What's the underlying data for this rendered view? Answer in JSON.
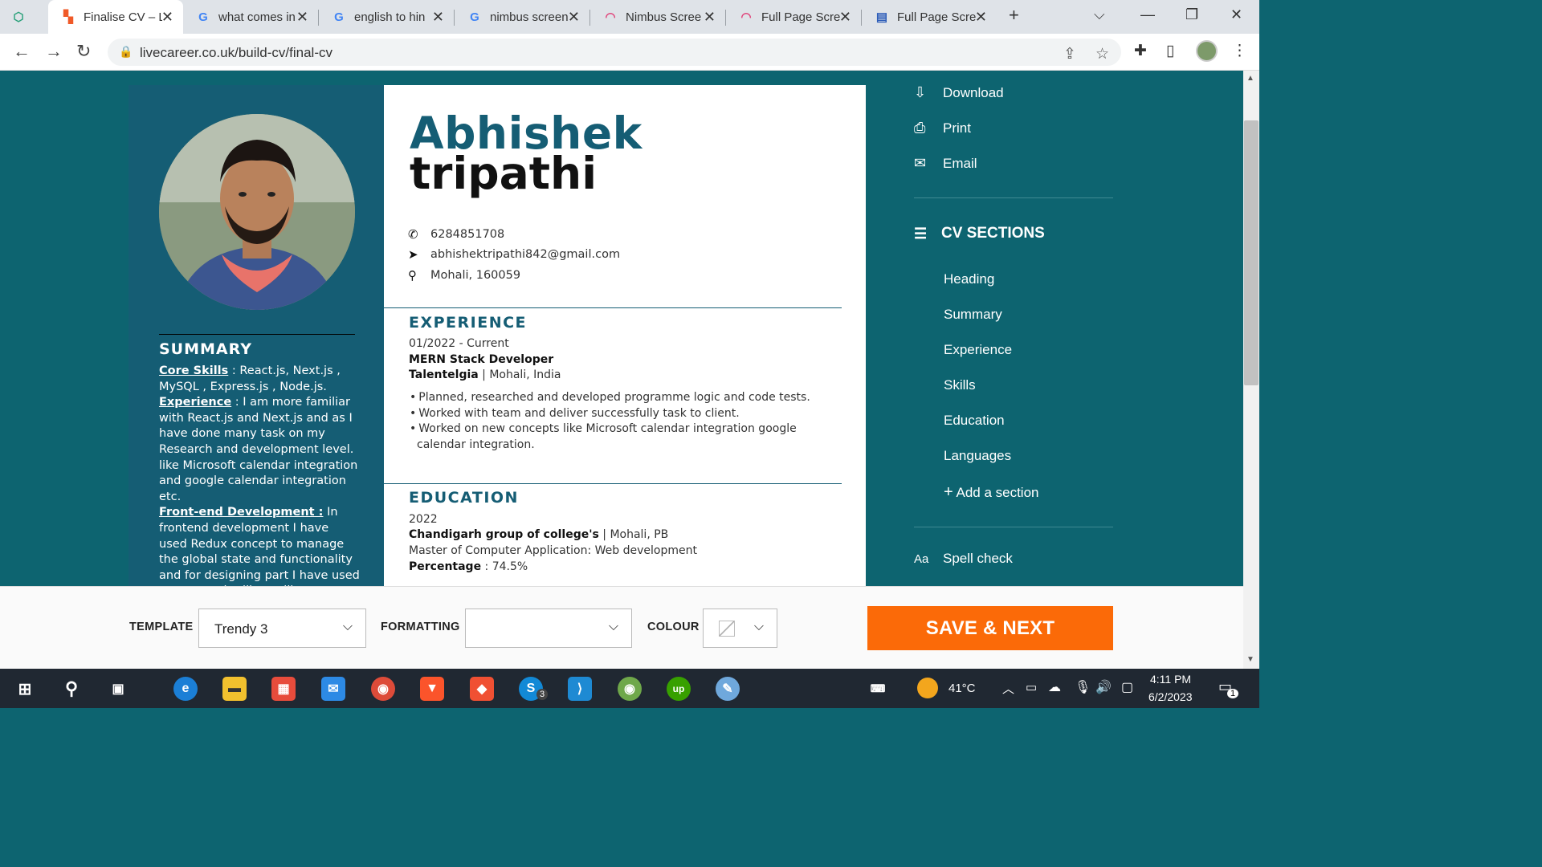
{
  "browser": {
    "tabs": [
      {
        "title": "Finalise CV – L",
        "favicon": "livecareer-icon",
        "active": true
      },
      {
        "title": "what comes in",
        "favicon": "google-icon",
        "active": false
      },
      {
        "title": "english to hin",
        "favicon": "google-icon",
        "active": false
      },
      {
        "title": "nimbus screen",
        "favicon": "google-icon",
        "active": false
      },
      {
        "title": "Nimbus Scree",
        "favicon": "nimbus-icon",
        "active": false
      },
      {
        "title": "Full Page Scre",
        "favicon": "nimbus-icon",
        "active": false
      },
      {
        "title": "Full Page Scre",
        "favicon": "page-icon",
        "active": false
      }
    ],
    "url": "livecareer.co.uk/build-cv/final-cv"
  },
  "cv": {
    "first_name": "Abhishek",
    "last_name": "tripathi",
    "phone": "6284851708",
    "email": "abhishektripathi842@gmail.com",
    "location": "Mohali, 160059",
    "summary": {
      "title": "SUMMARY",
      "core_skills_label": "Core Skills",
      "core_skills_text": " : React.js, Next.js , MySQL , Express.js , Node.js.",
      "experience_label": "Experience",
      "experience_text": " : I am more familiar with React.js and Next.js and as I have done many task on my Research and development level. like Microsoft calendar integration and google calendar integration etc.",
      "frontend_label": "Front-end Development :",
      "frontend_text": " In frontend development I have used Redux concept to manage the global state and functionality and for designing part I have used some popular library like : Chakra-ui, UI-"
    },
    "experience": {
      "title": "EXPERIENCE",
      "dates": "01/2022 - Current",
      "role": "MERN Stack Developer",
      "company": "Talentelgia",
      "company_location": " | Mohali, India",
      "bullets": [
        "Planned, researched and developed programme logic and code tests.",
        "Worked with team and deliver successfully task to client.",
        "Worked on new concepts like Microsoft calendar integration google calendar integration."
      ]
    },
    "education": {
      "title": "EDUCATION",
      "year": "2022",
      "school": "Chandigarh group of college's",
      "school_location": " | Mohali, PB",
      "degree": "Master of Computer Application: Web development",
      "percentage_label": "Percentage",
      "percentage_value": " : 74.5%"
    }
  },
  "right_panel": {
    "download": "Download",
    "print": "Print",
    "email": "Email",
    "sections_title": "CV SECTIONS",
    "sections": [
      "Heading",
      "Summary",
      "Experience",
      "Skills",
      "Education",
      "Languages"
    ],
    "add_section": "Add a section",
    "spell_check": "Spell check"
  },
  "toolbar": {
    "template_label": "TEMPLATE",
    "template_value": "Trendy 3",
    "formatting_label": "FORMATTING",
    "formatting_value": "",
    "colour_label": "COLOUR",
    "save_label": "SAVE & NEXT"
  },
  "taskbar": {
    "weather": "41°C",
    "time": "4:11 PM",
    "date": "6/2/2023",
    "skype_badge": "3",
    "notifications": "1"
  },
  "colors": {
    "page_bg": "#0d6470",
    "cv_accent": "#155d74",
    "save_button": "#fb6a08"
  }
}
